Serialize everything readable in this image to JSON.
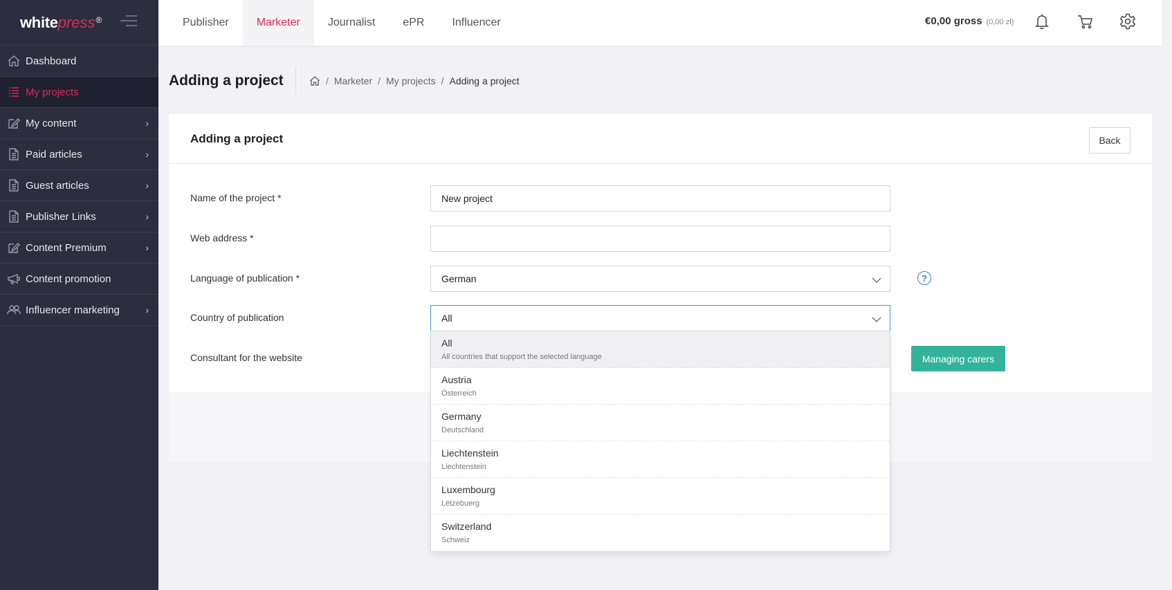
{
  "logo": {
    "white": "white",
    "press": "press",
    "reg": "®"
  },
  "sidebar": {
    "items": [
      {
        "label": "Dashboard",
        "icon": "home-icon",
        "chevron": false,
        "active": false
      },
      {
        "label": "My projects",
        "icon": "list-icon",
        "chevron": false,
        "active": true
      },
      {
        "label": "My content",
        "icon": "edit-icon",
        "chevron": true,
        "active": false
      },
      {
        "label": "Paid articles",
        "icon": "document-icon",
        "chevron": true,
        "active": false
      },
      {
        "label": "Guest articles",
        "icon": "document-icon",
        "chevron": true,
        "active": false
      },
      {
        "label": "Publisher Links",
        "icon": "document-icon",
        "chevron": true,
        "active": false
      },
      {
        "label": "Content Premium",
        "icon": "edit-icon",
        "chevron": true,
        "active": false
      },
      {
        "label": "Content promotion",
        "icon": "megaphone-icon",
        "chevron": false,
        "active": false
      },
      {
        "label": "Influencer marketing",
        "icon": "users-icon",
        "chevron": true,
        "active": false
      }
    ]
  },
  "topbar": {
    "tabs": [
      "Publisher",
      "Marketer",
      "Journalist",
      "ePR",
      "Influencer"
    ],
    "active_tab": "Marketer",
    "balance": "€0,00 gross",
    "balance_sub": "(0,00 zł)"
  },
  "header": {
    "title": "Adding a project",
    "breadcrumb": [
      "Marketer",
      "My projects",
      "Adding a project"
    ]
  },
  "card": {
    "title": "Adding a project",
    "back_label": "Back"
  },
  "form": {
    "name_label": "Name of the project *",
    "name_value": "New project",
    "web_label": "Web address *",
    "web_value": "",
    "language_label": "Language of publication *",
    "language_value": "German",
    "country_label": "Country of publication",
    "country_value": "All",
    "consultant_label": "Consultant for the website",
    "help_glyph": "?",
    "managing_label": "Managing carers"
  },
  "dropdown": {
    "options": [
      {
        "name": "All",
        "sub": "All countries that support the selected language",
        "selected": true
      },
      {
        "name": "Austria",
        "sub": "Österreich",
        "selected": false
      },
      {
        "name": "Germany",
        "sub": "Deutschland",
        "selected": false
      },
      {
        "name": "Liechtenstein",
        "sub": "Liechtenstein",
        "selected": false
      },
      {
        "name": "Luxembourg",
        "sub": "Lëtzebuerg",
        "selected": false
      },
      {
        "name": "Switzerland",
        "sub": "Schweiz",
        "selected": false
      }
    ]
  },
  "colors": {
    "brand": "#d62d57",
    "sidebar_bg": "#2c2e3d",
    "accent_green": "#33b39a",
    "focus_blue": "#4a90e2"
  }
}
